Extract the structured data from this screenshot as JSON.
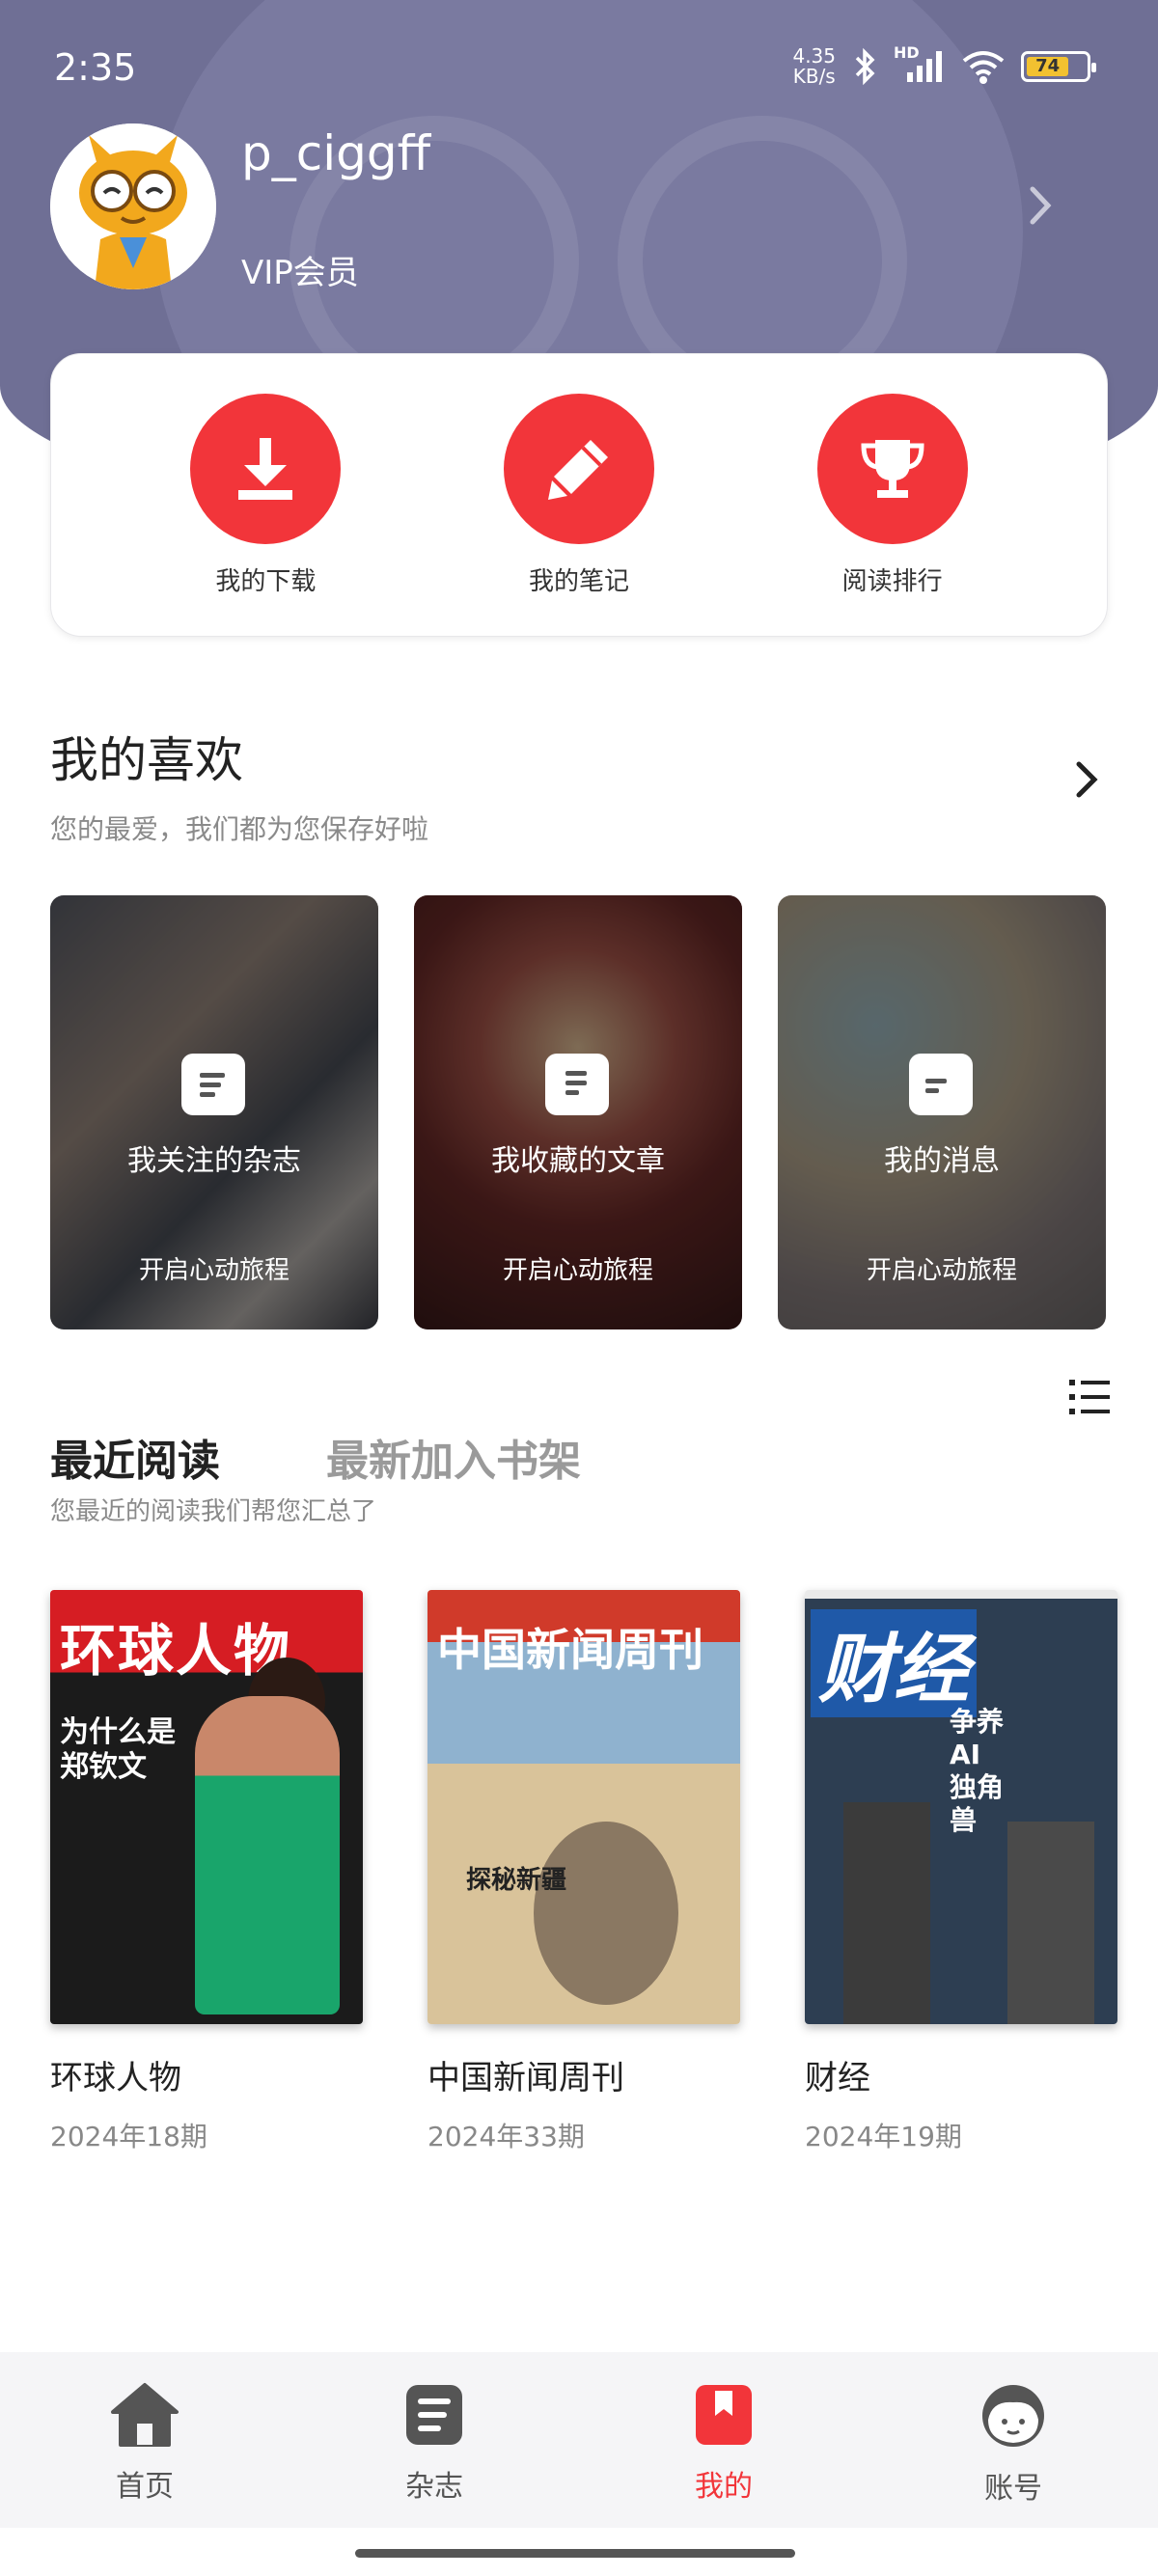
{
  "status_bar": {
    "time": "2:35",
    "net_speed_value": "4.35",
    "net_speed_unit": "KB/s",
    "network": "HD",
    "battery": "74"
  },
  "profile": {
    "username": "p_ciggff",
    "membership": "VIP会员"
  },
  "quick_actions": [
    {
      "label": "我的下载",
      "icon": "download-icon"
    },
    {
      "label": "我的笔记",
      "icon": "pencil-icon"
    },
    {
      "label": "阅读排行",
      "icon": "trophy-icon"
    }
  ],
  "favorites": {
    "title": "我的喜欢",
    "subtitle": "您的最爱，我们都为您保存好啦",
    "cards": [
      {
        "name": "我关注的杂志",
        "sub": "开启心动旅程"
      },
      {
        "name": "我收藏的文章",
        "sub": "开启心动旅程"
      },
      {
        "name": "我的消息",
        "sub": "开启心动旅程"
      }
    ]
  },
  "recent": {
    "tab_active": "最近阅读",
    "tab_inactive": "最新加入书架",
    "subtitle": "您最近的阅读我们帮您汇总了",
    "books": [
      {
        "title": "环球人物",
        "issue": "2024年18期",
        "cover_title": "环球人物",
        "cover_headline": "为什么是郑钦文"
      },
      {
        "title": "中国新闻周刊",
        "issue": "2024年33期",
        "cover_title": "中国新闻周刊",
        "cover_headline": "探秘新疆"
      },
      {
        "title": "财经",
        "issue": "2024年19期",
        "cover_title": "财经",
        "cover_headline": "争养AI独角兽"
      }
    ]
  },
  "bottom_nav": [
    {
      "label": "首页",
      "icon": "home-icon"
    },
    {
      "label": "杂志",
      "icon": "magazine-icon"
    },
    {
      "label": "我的",
      "icon": "bookmark-icon",
      "active": true
    },
    {
      "label": "账号",
      "icon": "face-icon"
    }
  ],
  "colors": {
    "accent": "#f2353a",
    "header": "#6f6f95"
  }
}
